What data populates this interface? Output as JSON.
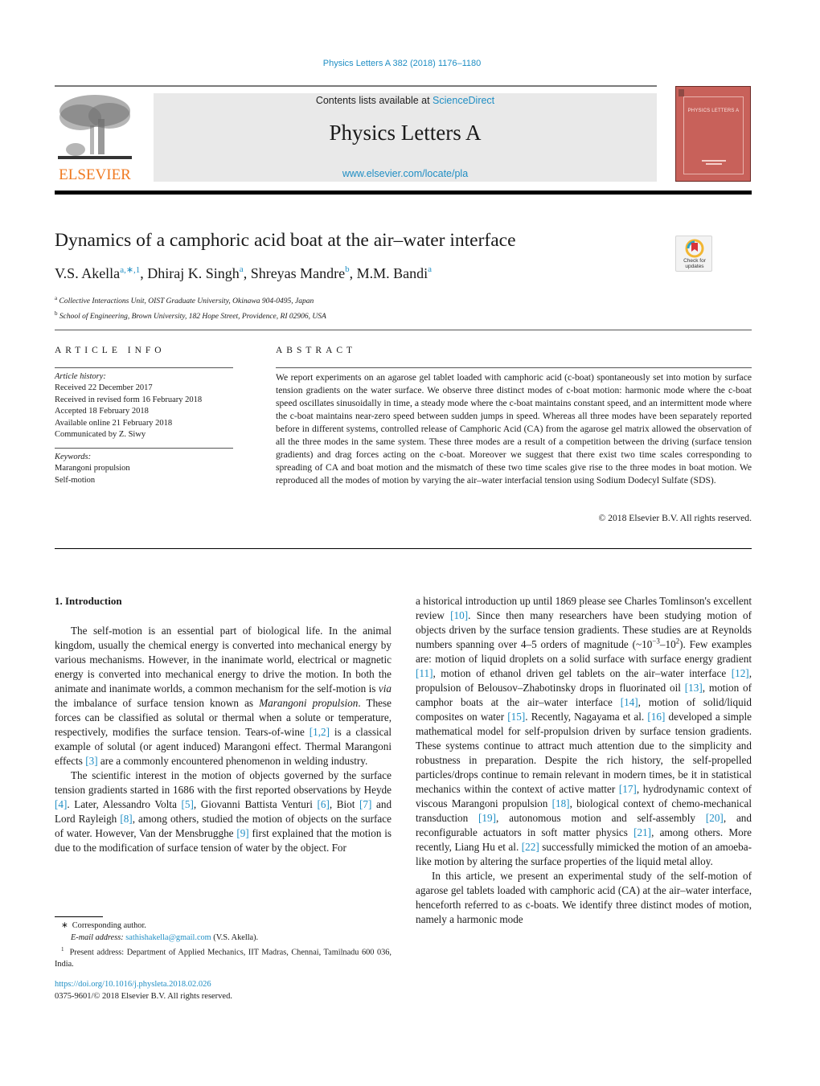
{
  "running_head": "Physics Letters A 382 (2018) 1176–1180",
  "masthead": {
    "publisher_logo_text": "ELSEVIER",
    "contents_prefix": "Contents lists available at ",
    "contents_link": "ScienceDirect",
    "journal_title": "Physics Letters A",
    "journal_url": "www.elsevier.com/locate/pla",
    "cover_title": "PHYSICS LETTERS A"
  },
  "crossmark": {
    "label_line1": "Check for",
    "label_line2": "updates"
  },
  "article": {
    "title": "Dynamics of a camphoric acid boat at the air–water interface",
    "authors": [
      {
        "name": "V.S. Akella",
        "sup": "a,∗,1"
      },
      {
        "name": "Dhiraj K. Singh",
        "sup": "a"
      },
      {
        "name": "Shreyas Mandre",
        "sup": "b"
      },
      {
        "name": "M.M. Bandi",
        "sup": "a"
      }
    ],
    "affiliations": [
      {
        "key": "a",
        "text": "Collective Interactions Unit, OIST Graduate University, Okinawa 904-0495, Japan"
      },
      {
        "key": "b",
        "text": "School of Engineering, Brown University, 182 Hope Street, Providence, RI 02906, USA"
      }
    ]
  },
  "article_info": {
    "heading": "ARTICLE INFO",
    "history_label": "Article history:",
    "history": [
      "Received 22 December 2017",
      "Received in revised form 16 February 2018",
      "Accepted 18 February 2018",
      "Available online 21 February 2018",
      "Communicated by Z. Siwy"
    ],
    "keywords_label": "Keywords:",
    "keywords": [
      "Marangoni propulsion",
      "Self-motion"
    ]
  },
  "abstract": {
    "heading": "ABSTRACT",
    "text": "We report experiments on an agarose gel tablet loaded with camphoric acid (c-boat) spontaneously set into motion by surface tension gradients on the water surface. We observe three distinct modes of c-boat motion: harmonic mode where the c-boat speed oscillates sinusoidally in time, a steady mode where the c-boat maintains constant speed, and an intermittent mode where the c-boat maintains near-zero speed between sudden jumps in speed. Whereas all three modes have been separately reported before in different systems, controlled release of Camphoric Acid (CA) from the agarose gel matrix allowed the observation of all the three modes in the same system. These three modes are a result of a competition between the driving (surface tension gradients) and drag forces acting on the c-boat. Moreover we suggest that there exist two time scales corresponding to spreading of CA and boat motion and the mismatch of these two time scales give rise to the three modes in boat motion. We reproduced all the modes of motion by varying the air–water interfacial tension using Sodium Dodecyl Sulfate (SDS).",
    "copyright": "© 2018 Elsevier B.V. All rights reserved."
  },
  "body": {
    "section_title": "1. Introduction",
    "p1": {
      "a": "The self-motion is an essential part of biological life. In the animal kingdom, usually the chemical energy is converted into mechanical energy by various mechanisms. However, in the inanimate world, electrical or magnetic energy is converted into mechanical energy to drive the motion. In both the animate and inanimate worlds, a common mechanism for the self-motion is ",
      "via": "via",
      "b": " the imbalance of surface tension known as ",
      "mp": "Marangoni propulsion",
      "c": ". These forces can be classified as solutal or thermal when a solute or temperature, respectively, modifies the surface tension. Tears-of-wine ",
      "ref1": "[1,2]",
      "d": " is a classical example of solutal (or agent induced) Marangoni effect. Thermal Marangoni effects ",
      "ref2": "[3]",
      "e": " are a commonly encountered phenomenon in welding industry."
    },
    "p2": {
      "a": "The scientific interest in the motion of objects governed by the surface tension gradients started in 1686 with the first reported observations by Heyde ",
      "r4": "[4]",
      "b": ". Later, Alessandro Volta ",
      "r5": "[5]",
      "c": ", Giovanni Battista Venturi ",
      "r6": "[6]",
      "d": ", Biot ",
      "r7": "[7]",
      "e": " and Lord Rayleigh ",
      "r8": "[8]",
      "f": ", among others, studied the motion of objects on the surface of water. However, Van der Mensbrugghe ",
      "r9": "[9]",
      "g": " first explained that the motion is due to the modification of surface tension of water by the object. For a historical introduction up until 1869 please see Charles Tomlinson's excellent review ",
      "r10": "[10]",
      "h": ". Since then many researchers have been studying motion of objects driven by the surface tension gradients. These studies are at Reynolds numbers spanning over 4–5 orders of magnitude (~10",
      "exp1": "−3",
      "i": "–10",
      "exp2": "2",
      "j": "). Few examples are: motion of liquid droplets on a solid surface with surface energy gradient ",
      "r11": "[11]",
      "k": ", motion of ethanol driven gel tablets on the air–water interface ",
      "r12": "[12]",
      "l": ", propulsion of Belousov–Zhabotinsky drops in fluorinated oil ",
      "r13": "[13]",
      "m": ", motion of camphor boats at the air–water interface ",
      "r14": "[14]",
      "n": ", motion of solid/liquid composites on water ",
      "r15": "[15]",
      "o": ". Recently, Nagayama et al. ",
      "r16": "[16]",
      "p": " developed a simple mathematical model for self-propulsion driven by surface tension gradients. These systems continue to attract much attention due to the simplicity and robustness in preparation. Despite the rich history, the self-propelled particles/drops continue to remain relevant in modern times, be it in statistical mechanics within the context of active matter ",
      "r17": "[17]",
      "q": ", hydrodynamic context of viscous Marangoni propulsion ",
      "r18": "[18]",
      "r": ", biological context of chemo-mechanical transduction ",
      "r19": "[19]",
      "s": ", autonomous motion and self-assembly ",
      "r20": "[20]",
      "t": ", and reconfigurable actuators in soft matter physics ",
      "r21": "[21]",
      "u": ", among others. More recently, Liang Hu et al. ",
      "r22": "[22]",
      "v": " successfully mimicked the motion of an amoeba-like motion by altering the surface properties of the liquid metal alloy."
    },
    "p3": "In this article, we present an experimental study of the self-motion of agarose gel tablets loaded with camphoric acid (CA) at the air–water interface, henceforth referred to as c-boats. We identify three distinct modes of motion, namely a harmonic mode"
  },
  "footnotes": {
    "star_mark": "∗",
    "star_text": "Corresponding author.",
    "email_label": "E-mail address:",
    "email": "sathishakella@gmail.com",
    "email_owner": " (V.S. Akella).",
    "one_mark": "1",
    "one_text": "Present address: Department of Applied Mechanics, IIT Madras, Chennai, Tamilnadu 600 036, India."
  },
  "doi": {
    "url": "https://doi.org/10.1016/j.physleta.2018.02.026",
    "issn_line": "0375-9601/© 2018 Elsevier B.V. All rights reserved."
  },
  "colors": {
    "link": "#1f8ec4",
    "elsevier_orange": "#f07a21",
    "cover_red": "#c8615a",
    "banner_gray": "#e9e9e9"
  }
}
